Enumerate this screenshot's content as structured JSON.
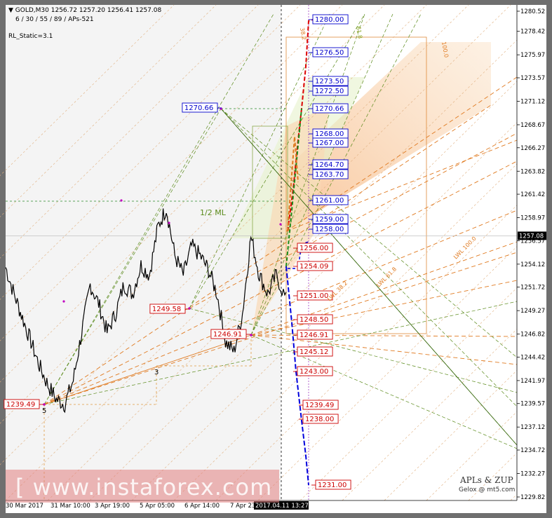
{
  "header": {
    "symbol_line": "GOLD,M30  1256.72  1257.20  1256.41  1257.08",
    "params": "6 / 30 / 55 / 89 / APs-521",
    "rl_static": "RL_Static=3.1"
  },
  "watermark": {
    "text": "[ www.instaforex.com ]",
    "brand": "APLs & ZUP",
    "brand_sub": "Gelox @ mt5.com"
  },
  "colors": {
    "up": "#0000dd",
    "down": "#dd0000",
    "fork_green": "#5a8a1a",
    "fork_orange": "#e07a20",
    "current_price_bg": "#000000"
  },
  "chart_data": {
    "type": "line",
    "symbol": "GOLD",
    "timeframe": "M30",
    "ylim": [
      1229.0,
      1281.5
    ],
    "y_ticks": [
      1280.52,
      1278.42,
      1275.97,
      1273.57,
      1271.12,
      1268.67,
      1266.27,
      1263.82,
      1261.42,
      1258.97,
      1256.57,
      1254.12,
      1251.72,
      1249.27,
      1246.82,
      1244.42,
      1241.97,
      1239.57,
      1237.12,
      1234.72,
      1232.27,
      1229.82
    ],
    "current_price": 1257.08,
    "x_ticks": [
      "30 Mar 2017",
      "31 Mar 10:00",
      "3 Apr 19:00",
      "5 Apr 05:00",
      "6 Apr 14:00",
      "7 Apr 23:00"
    ],
    "current_time_label": "2017.04.11 13:27",
    "price_path": [
      [
        0,
        1253.8
      ],
      [
        0.03,
        1251
      ],
      [
        0.06,
        1248.5
      ],
      [
        0.09,
        1246
      ],
      [
        0.12,
        1243.5
      ],
      [
        0.15,
        1241.5
      ],
      [
        0.18,
        1240
      ],
      [
        0.21,
        1239.5
      ],
      [
        0.24,
        1242
      ],
      [
        0.27,
        1247
      ],
      [
        0.3,
        1252
      ],
      [
        0.33,
        1250
      ],
      [
        0.36,
        1247
      ],
      [
        0.39,
        1249
      ],
      [
        0.42,
        1252
      ],
      [
        0.45,
        1251
      ],
      [
        0.48,
        1254
      ],
      [
        0.51,
        1253
      ],
      [
        0.54,
        1258
      ],
      [
        0.57,
        1260
      ],
      [
        0.6,
        1255
      ],
      [
        0.63,
        1253
      ],
      [
        0.66,
        1256
      ],
      [
        0.69,
        1255
      ],
      [
        0.72,
        1253.5
      ],
      [
        0.75,
        1251
      ],
      [
        0.78,
        1246
      ],
      [
        0.81,
        1245
      ],
      [
        0.84,
        1249
      ],
      [
        0.87,
        1257
      ],
      [
        0.9,
        1253
      ],
      [
        0.93,
        1251
      ],
      [
        0.96,
        1253
      ],
      [
        1.0,
        1250
      ]
    ],
    "pivots": [
      {
        "label": "1239.49",
        "price": 1239.49,
        "num": "5",
        "color": "red"
      },
      {
        "label": "1249.58",
        "price": 1249.58,
        "num": "3",
        "color": "red"
      },
      {
        "label": "1270.66",
        "price": 1270.66,
        "num": "",
        "color": "blue"
      },
      {
        "label": "1246.91",
        "price": 1246.91,
        "num": "",
        "color": "red"
      }
    ],
    "targets_up": [
      "1280.00",
      "1276.50",
      "1273.50",
      "1272.50",
      "1270.66",
      "1268.00",
      "1267.00",
      "1264.70",
      "1263.70",
      "1261.00",
      "1259.00",
      "1258.00"
    ],
    "targets_down": [
      "1256.00",
      "1254.09",
      "1251.00",
      "1248.50",
      "1246.91",
      "1245.12",
      "1243.00",
      "1239.49",
      "1238.00",
      "1231.00"
    ],
    "annotations": [
      "1/2 ML",
      "LWL 100.0",
      "LWL 61.8",
      "LWL 38.2",
      "100.0",
      "61.8",
      "38.2"
    ]
  }
}
